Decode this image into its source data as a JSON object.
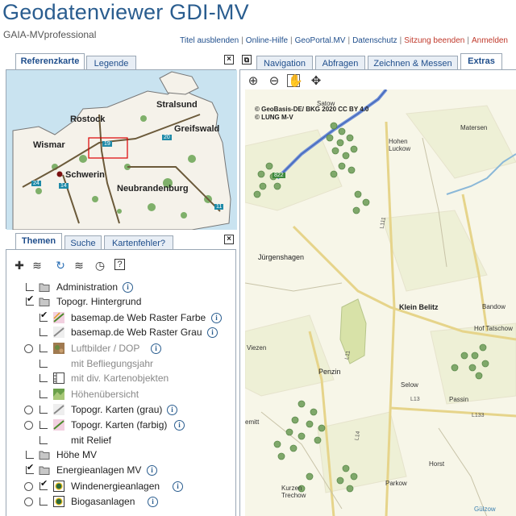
{
  "header": {
    "title": "Geodatenviewer GDI-MV",
    "subtitle": "GAIA-MVprofessional",
    "links": [
      {
        "label": "Titel ausblenden",
        "red": false
      },
      {
        "label": "Online-Hilfe",
        "red": false
      },
      {
        "label": "GeoPortal.MV",
        "red": false
      },
      {
        "label": "Datenschutz",
        "red": false
      },
      {
        "label": "Sitzung beenden",
        "red": true
      },
      {
        "label": "Anmelden",
        "red": true
      }
    ]
  },
  "overview": {
    "tabs": [
      "Referenzkarte",
      "Legende"
    ],
    "active_tab": "Referenzkarte",
    "close": "×",
    "places": [
      "Stralsund",
      "Rostock",
      "Greifswald",
      "Wismar",
      "Schwerin",
      "Neubrandenburg"
    ],
    "road_shields": [
      "19",
      "20",
      "24",
      "14",
      "11"
    ]
  },
  "layers_panel": {
    "tabs": [
      "Themen",
      "Suche",
      "Kartenfehler?"
    ],
    "active_tab": "Themen",
    "close": "×",
    "tools": [
      "add-icon",
      "layers-icon",
      "refresh-icon",
      "layers-stack-icon",
      "clock-icon",
      "help-icon"
    ],
    "items": [
      {
        "label": "Administration",
        "info": true,
        "gray": false
      },
      {
        "label": "Topogr. Hintergrund",
        "info": false,
        "gray": false
      },
      {
        "label": "basemap.de Web Raster Farbe",
        "info": true,
        "gray": false
      },
      {
        "label": "basemap.de Web Raster Grau",
        "info": true,
        "gray": false
      },
      {
        "label": "Luftbilder / DOP",
        "info": true,
        "gray": true
      },
      {
        "label": "mit Befliegungsjahr",
        "info": false,
        "gray": true
      },
      {
        "label": "mit div. Kartenobjekten",
        "info": false,
        "gray": true
      },
      {
        "label": "Höhenübersicht",
        "info": false,
        "gray": true
      },
      {
        "label": "Topogr. Karten (grau)",
        "info": true,
        "gray": false
      },
      {
        "label": "Topogr. Karten (farbig)",
        "info": true,
        "gray": false
      },
      {
        "label": "mit Relief",
        "info": false,
        "gray": false
      },
      {
        "label": "Höhe MV",
        "info": false,
        "gray": false
      },
      {
        "label": "Energieanlagen MV",
        "info": true,
        "gray": false
      },
      {
        "label": "Windenergieanlagen",
        "info": true,
        "gray": false
      },
      {
        "label": "Biogasanlagen",
        "info": true,
        "gray": false
      }
    ]
  },
  "map_panel": {
    "tabs": [
      "Navigation",
      "Abfragen",
      "Zeichnen & Messen",
      "Extras"
    ],
    "active_tab": "Extras",
    "tools": [
      "zoom-in-icon",
      "zoom-out-icon",
      "pan-hand-icon",
      "move-icon"
    ],
    "copyright": [
      "© GeoBasis-DE/ BKG 2020 CC BY 4.0",
      "© LUNG M-V"
    ],
    "places": [
      "Satow",
      "Matersen",
      "Hohen Luckow",
      "Jürgenshagen",
      "Klein Belitz",
      "Bandow",
      "Hof Tatschow",
      "Viezen",
      "Penzin",
      "Selow",
      "Passin",
      "Horst",
      "Parkow",
      "Kurzen Trechow",
      "emitt",
      "Gülzow"
    ],
    "road_labels": [
      "L11",
      "L13",
      "L133",
      "L133",
      "L111",
      "L14",
      "822"
    ]
  }
}
